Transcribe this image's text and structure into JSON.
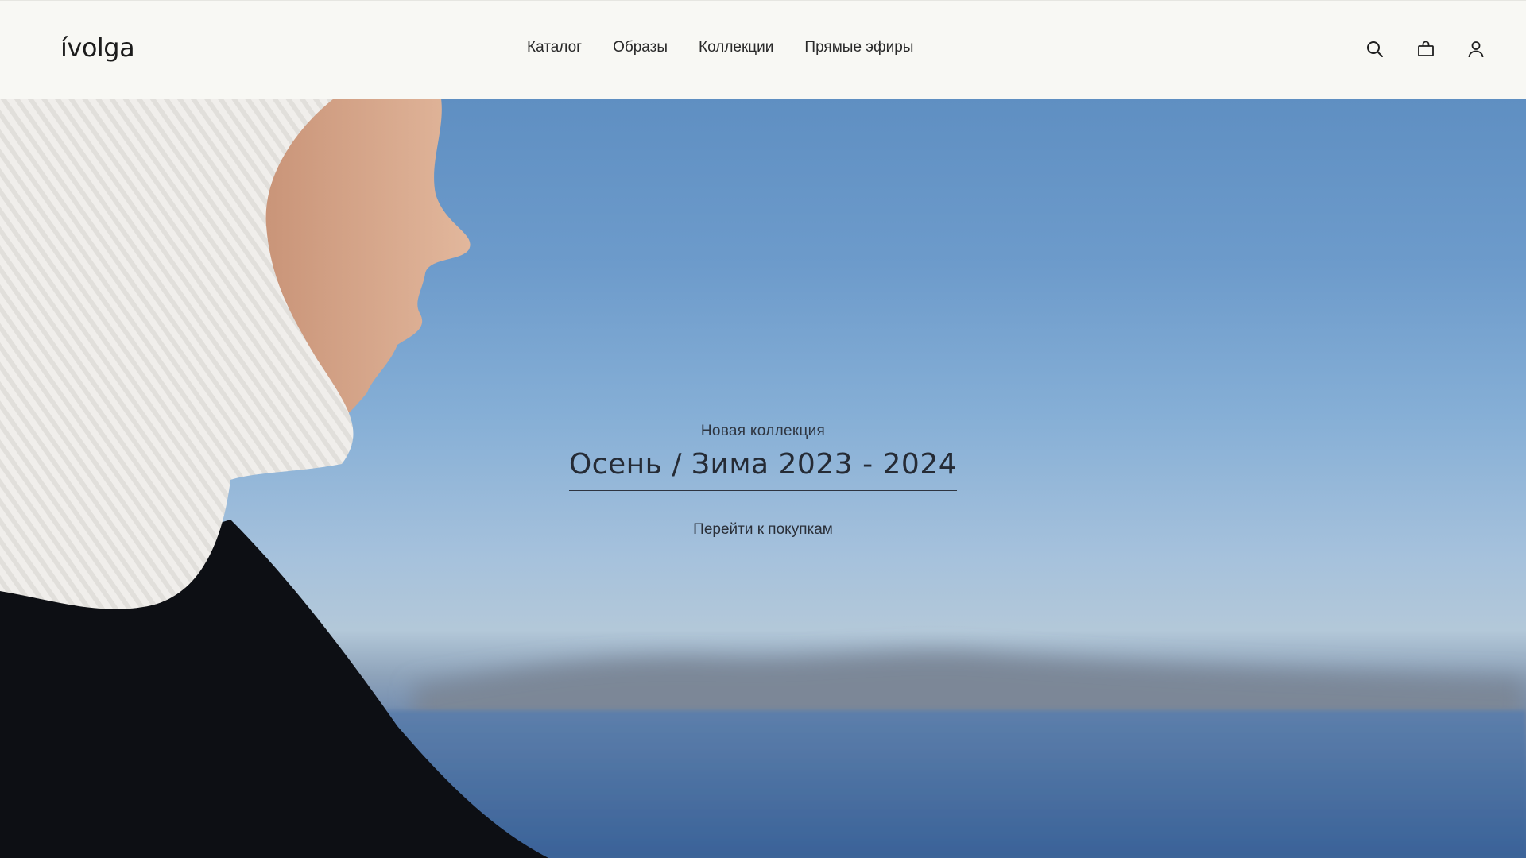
{
  "brand": {
    "logo_text": "ívolga"
  },
  "nav": {
    "items": [
      {
        "label": "Каталог"
      },
      {
        "label": "Образы"
      },
      {
        "label": "Коллекции"
      },
      {
        "label": "Прямые эфиры"
      }
    ]
  },
  "header_icons": [
    {
      "name": "search-icon"
    },
    {
      "name": "shopping-bag-icon"
    },
    {
      "name": "user-icon"
    }
  ],
  "hero": {
    "kicker": "Новая коллекция",
    "headline": "Осень / Зима 2023 - 2024",
    "cta_label": "Перейти к покупкам"
  },
  "colors": {
    "header_bg": "#f8f8f4",
    "text": "#1c1c1c",
    "sky_top": "#5f8fc2",
    "sky_bottom": "#b3c8d9",
    "sea": "#3f669a"
  }
}
